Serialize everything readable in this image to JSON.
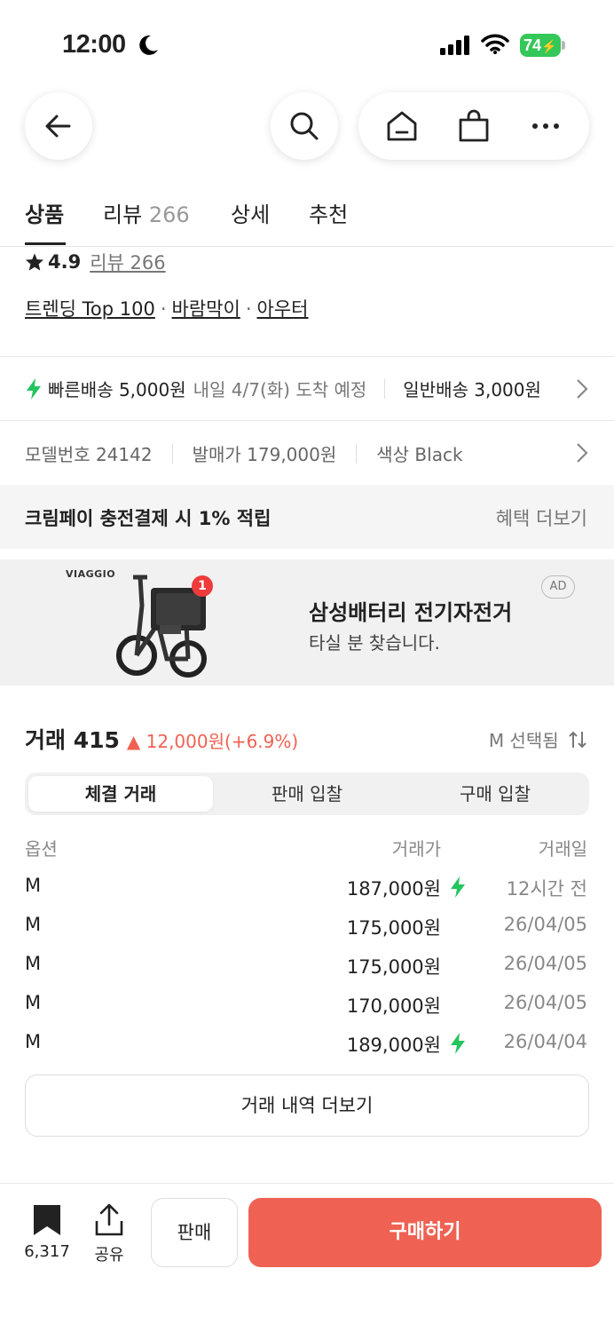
{
  "status": {
    "time": "12:00",
    "battery": "74"
  },
  "tabs": [
    {
      "label": "상품",
      "count": ""
    },
    {
      "label": "리뷰",
      "count": "266"
    },
    {
      "label": "상세",
      "count": ""
    },
    {
      "label": "추천",
      "count": ""
    }
  ],
  "rating": {
    "score": "4.9",
    "reviews": "리뷰 266"
  },
  "categories": {
    "trend": "트렌딩 Top 100",
    "c1": "바람막이",
    "c2": "아우터",
    "dot": "·"
  },
  "shipping": {
    "fast_label": "빠른배송 5,000원",
    "fast_eta": "내일 4/7(화) 도착 예정",
    "normal_label": "일반배송 3,000원"
  },
  "spec": {
    "model": "모델번호 24142",
    "release": "발매가 179,000원",
    "color": "색상 Black"
  },
  "benefit": {
    "left": "크림페이 충전결제 시 1% 적립",
    "right": "혜택 더보기"
  },
  "ad": {
    "brand": "VIAGGIO",
    "title": "삼성배터리 전기자전거",
    "subtitle": "타실 분 찾습니다.",
    "badge": "AD",
    "notif": "1"
  },
  "trade": {
    "title": "거래 415",
    "change": "▲ 12,000원(+6.9%)",
    "selected": "M 선택됨",
    "segments": [
      "체결 거래",
      "판매 입찰",
      "구매 입찰"
    ],
    "headers": {
      "option": "옵션",
      "price": "거래가",
      "date": "거래일"
    },
    "rows": [
      {
        "option": "M",
        "price": "187,000원",
        "fast": true,
        "date": "12시간 전"
      },
      {
        "option": "M",
        "price": "175,000원",
        "fast": false,
        "date": "26/04/05"
      },
      {
        "option": "M",
        "price": "175,000원",
        "fast": false,
        "date": "26/04/05"
      },
      {
        "option": "M",
        "price": "170,000원",
        "fast": false,
        "date": "26/04/05"
      },
      {
        "option": "M",
        "price": "189,000원",
        "fast": true,
        "date": "26/04/04"
      }
    ],
    "more": "거래 내역 더보기"
  },
  "bottom": {
    "bookmark_count": "6,317",
    "share": "공유",
    "sell": "판매",
    "buy": "구매하기"
  },
  "colors": {
    "accent": "#ef6253",
    "fast": "#22c55e",
    "battery": "#34c759"
  }
}
